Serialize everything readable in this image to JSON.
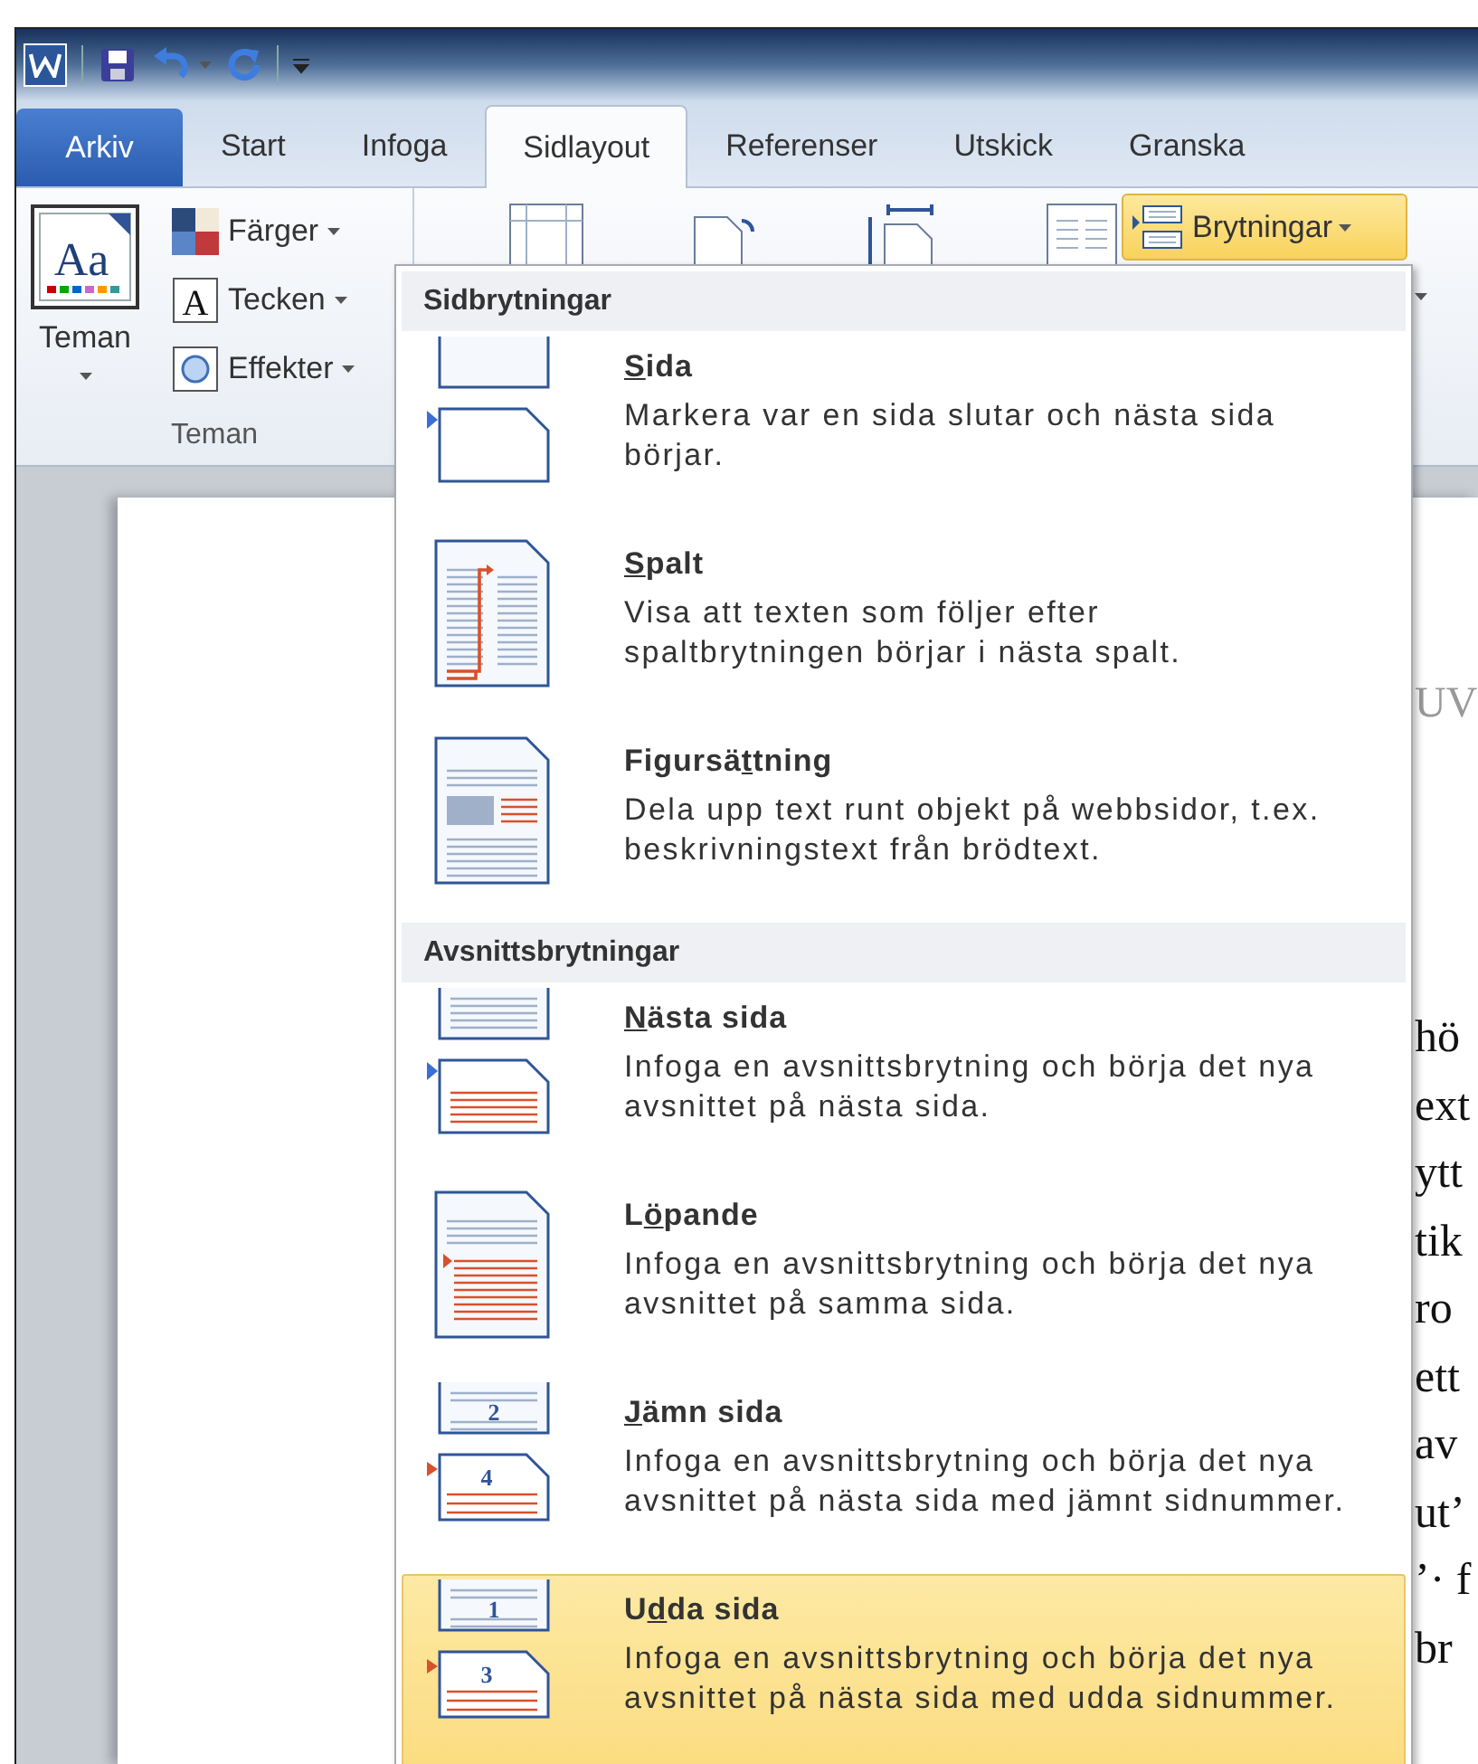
{
  "tabs": [
    {
      "label": "Arkiv",
      "kind": "file",
      "selected": false
    },
    {
      "label": "Start",
      "kind": "tab",
      "selected": false
    },
    {
      "label": "Infoga",
      "kind": "tab",
      "selected": false
    },
    {
      "label": "Sidlayout",
      "kind": "tab",
      "selected": true
    },
    {
      "label": "Referenser",
      "kind": "tab",
      "selected": false
    },
    {
      "label": "Utskick",
      "kind": "tab",
      "selected": false
    },
    {
      "label": "Granska",
      "kind": "tab",
      "selected": false
    }
  ],
  "ribbon": {
    "themes_group": {
      "label": "Teman",
      "big_button": "Teman",
      "icon_text": "Aa",
      "buttons": [
        {
          "label": "Färger",
          "kind": "colors"
        },
        {
          "label": "Tecken",
          "kind": "fonts",
          "icon_text": "A"
        },
        {
          "label": "Effekter",
          "kind": "effects"
        }
      ]
    },
    "breaks_button": {
      "label": "Brytningar",
      "open": true
    }
  },
  "menu": {
    "sections": [
      {
        "title": "Sidbrytningar",
        "items": [
          {
            "kind": "page",
            "title": {
              "key": "S",
              "post": "ida"
            },
            "description": [
              "Markera var en sida slutar och nästa sida",
              "börjar."
            ],
            "selected": false
          },
          {
            "kind": "column",
            "title": {
              "key": "S",
              "post": "palt"
            },
            "description": [
              "Visa att texten som följer efter",
              "spaltbrytningen börjar i nästa spalt."
            ],
            "selected": false
          },
          {
            "kind": "wrapping",
            "title": {
              "pre": "Figursä",
              "key": "t",
              "post": "tning"
            },
            "description": [
              "Dela upp text runt objekt på webbsidor, t.ex.",
              "beskrivningstext från brödtext."
            ],
            "selected": false
          }
        ]
      },
      {
        "title": "Avsnittsbrytningar",
        "items": [
          {
            "kind": "next-page",
            "title": {
              "key": "N",
              "post": "ästa sida"
            },
            "description": [
              "Infoga en avsnittsbrytning och börja det nya",
              "avsnittet på nästa sida."
            ],
            "selected": false
          },
          {
            "kind": "continuous",
            "title": {
              "pre": "L",
              "key": "ö",
              "post": "pande"
            },
            "description": [
              "Infoga en avsnittsbrytning och börja det nya",
              "avsnittet på samma sida."
            ],
            "selected": false
          },
          {
            "kind": "even-page",
            "title": {
              "key": "J",
              "post": "ämn sida"
            },
            "description": [
              "Infoga en avsnittsbrytning och börja det nya",
              "avsnittet på nästa sida med jämnt sidnummer."
            ],
            "icon_labels": [
              "2",
              "4"
            ],
            "selected": false
          },
          {
            "kind": "odd-page",
            "title": {
              "pre": "U",
              "key": "d",
              "post": "da sida"
            },
            "description": [
              "Infoga en avsnittsbrytning och börja det nya",
              "avsnittet på nästa sida med udda sidnummer."
            ],
            "icon_labels": [
              "1",
              "3"
            ],
            "selected": true
          }
        ]
      }
    ]
  },
  "document": {
    "heading_fragment": "UV",
    "line_fragments": [
      "hö",
      "ext",
      "ytt",
      "tik",
      "ro",
      "ett",
      "av",
      "ut’",
      "’· f",
      "br"
    ]
  }
}
